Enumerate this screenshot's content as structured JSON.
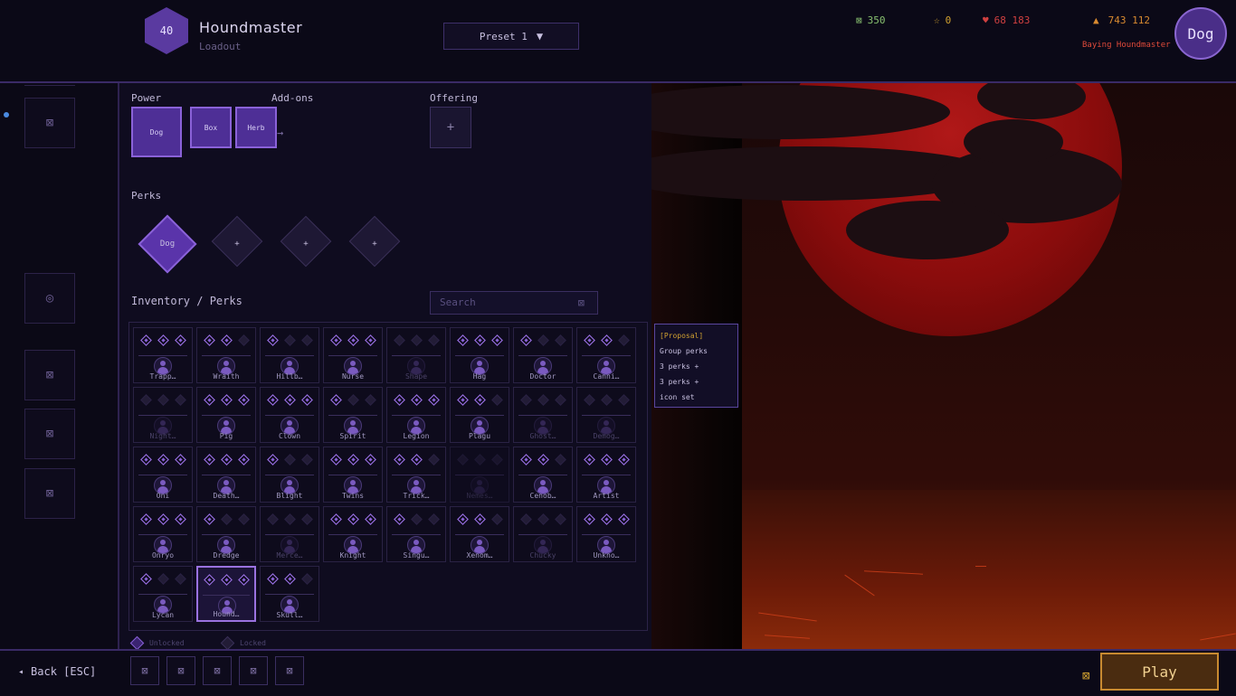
{
  "header": {
    "level": "40",
    "character_name": "Houndmaster",
    "character_subtitle": "Loadout",
    "preset_label": "Preset 1",
    "currencies": {
      "shards": "350",
      "stars": "0",
      "bloodpoints": "68 183",
      "iridescent": "743 112"
    },
    "player_title": "Baying Houndmaster",
    "avatar_label": "Dog"
  },
  "left_rail": {
    "icon_glyph": "⊠",
    "target_glyph": "◎"
  },
  "loadout": {
    "power_label": "Power",
    "addons_label": "Add-ons",
    "offering_label": "Offering",
    "power_item": "Dog",
    "addon_1": "Box",
    "addon_2": "Herb",
    "addon_arrow": "→",
    "offering_empty": "+",
    "perks_label": "Perks",
    "perk_1": "Dog",
    "perk_2": "+",
    "perk_3": "+",
    "perk_4": "+",
    "inventory_label": "Inventory / Perks",
    "search_placeholder": "Search",
    "search_clear": "⊠"
  },
  "inventory": [
    {
      "name": "Trapp…",
      "gems": [
        1,
        1,
        1
      ],
      "locked": false
    },
    {
      "name": "Wraith",
      "gems": [
        1,
        1,
        0
      ],
      "locked": false
    },
    {
      "name": "Hillb…",
      "gems": [
        1,
        0,
        0
      ],
      "locked": false
    },
    {
      "name": "Nurse",
      "gems": [
        1,
        1,
        1
      ],
      "locked": false
    },
    {
      "name": "Shape",
      "gems": [
        0,
        0,
        0
      ],
      "locked": true
    },
    {
      "name": "Hag",
      "gems": [
        1,
        1,
        1
      ],
      "locked": false
    },
    {
      "name": "Doctor",
      "gems": [
        1,
        0,
        0
      ],
      "locked": false
    },
    {
      "name": "Canni…",
      "gems": [
        1,
        1,
        0
      ],
      "locked": false
    },
    {
      "name": "Night…",
      "gems": [
        0,
        0,
        0
      ],
      "locked": true
    },
    {
      "name": "Pig",
      "gems": [
        1,
        1,
        1
      ],
      "locked": false
    },
    {
      "name": "Clown",
      "gems": [
        1,
        1,
        1
      ],
      "locked": false
    },
    {
      "name": "Spirit",
      "gems": [
        1,
        0,
        0
      ],
      "locked": false
    },
    {
      "name": "Legion",
      "gems": [
        1,
        1,
        1
      ],
      "locked": false
    },
    {
      "name": "Plagu",
      "gems": [
        1,
        1,
        0
      ],
      "locked": false
    },
    {
      "name": "Ghost…",
      "gems": [
        0,
        0,
        0
      ],
      "locked": true
    },
    {
      "name": "Demog…",
      "gems": [
        0,
        0,
        0
      ],
      "locked": true
    },
    {
      "name": "Oni",
      "gems": [
        1,
        1,
        1
      ],
      "locked": false
    },
    {
      "name": "Death…",
      "gems": [
        1,
        1,
        1
      ],
      "locked": false
    },
    {
      "name": "Blight",
      "gems": [
        1,
        0,
        0
      ],
      "locked": false
    },
    {
      "name": "Twins",
      "gems": [
        1,
        1,
        1
      ],
      "locked": false
    },
    {
      "name": "Trick…",
      "gems": [
        1,
        1,
        0
      ],
      "locked": false
    },
    {
      "name": "Nemes…",
      "gems": [
        0,
        0,
        0
      ],
      "locked": true,
      "dim": true
    },
    {
      "name": "Cenob…",
      "gems": [
        1,
        1,
        0
      ],
      "locked": false
    },
    {
      "name": "Artist",
      "gems": [
        1,
        1,
        1
      ],
      "locked": false
    },
    {
      "name": "Onryo",
      "gems": [
        1,
        1,
        1
      ],
      "locked": false
    },
    {
      "name": "Dredge",
      "gems": [
        1,
        0,
        0
      ],
      "locked": false
    },
    {
      "name": "Merce…",
      "gems": [
        0,
        0,
        0
      ],
      "locked": true
    },
    {
      "name": "Knight",
      "gems": [
        1,
        1,
        1
      ],
      "locked": false
    },
    {
      "name": "Singu…",
      "gems": [
        1,
        0,
        0
      ],
      "locked": false
    },
    {
      "name": "Xenom…",
      "gems": [
        1,
        1,
        0
      ],
      "locked": false
    },
    {
      "name": "Chucky",
      "gems": [
        0,
        0,
        0
      ],
      "locked": true
    },
    {
      "name": "Unkno…",
      "gems": [
        1,
        1,
        1
      ],
      "locked": false
    },
    {
      "name": "Lycan",
      "gems": [
        1,
        0,
        0
      ],
      "locked": false
    },
    {
      "name": "Hound…",
      "gems": [
        1,
        1,
        1
      ],
      "locked": false,
      "selected": true
    },
    {
      "name": "Skull…",
      "gems": [
        1,
        1,
        0
      ],
      "locked": false
    }
  ],
  "legend": {
    "unlocked": "Unlocked",
    "locked": "Locked"
  },
  "tooltip": {
    "title": "[Proposal]",
    "line1": "Group perks",
    "line2": "3 perks +",
    "line3": "3 perks +",
    "line4": "icon set"
  },
  "footer": {
    "back_arrow": "◂",
    "back_label": "Back [ESC]",
    "quick_glyph": "⊠",
    "play_label": "Play"
  },
  "colors": {
    "accent": "#8a62d8",
    "play": "#c88a30",
    "moon": "#b01818"
  }
}
